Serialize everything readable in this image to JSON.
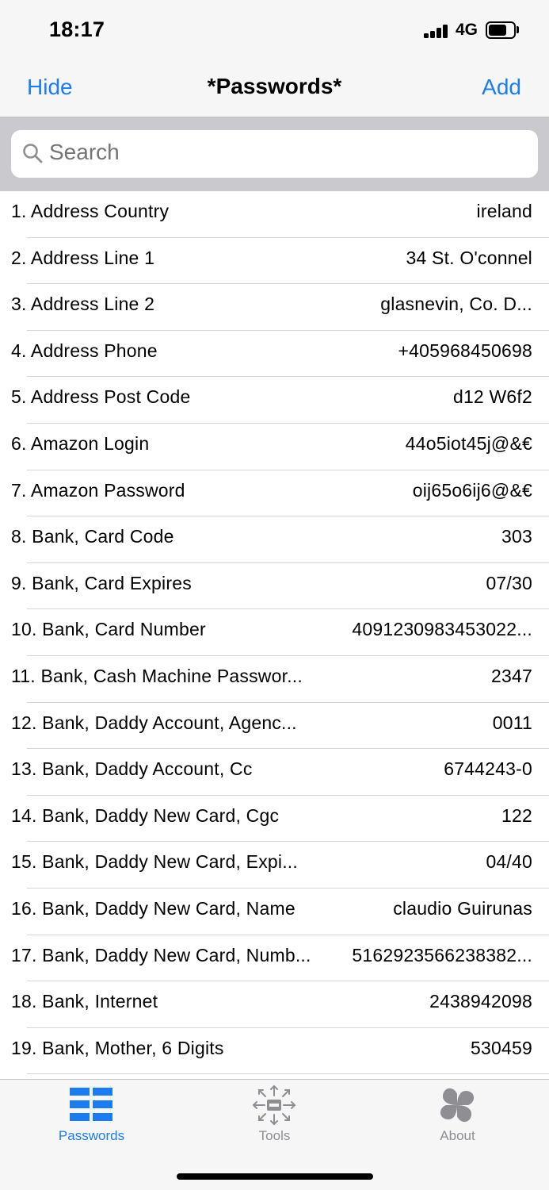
{
  "status": {
    "time": "18:17",
    "network": "4G"
  },
  "nav": {
    "left": "Hide",
    "title": "*Passwords*",
    "right": "Add"
  },
  "search": {
    "placeholder": "Search",
    "value": ""
  },
  "list": [
    {
      "label": "1. Address Country",
      "value": "ireland"
    },
    {
      "label": "2. Address Line 1",
      "value": "34 St. O'connel"
    },
    {
      "label": "3. Address Line 2",
      "value": "glasnevin, Co. D..."
    },
    {
      "label": "4. Address Phone",
      "value": "+405968450698"
    },
    {
      "label": "5. Address Post Code",
      "value": "d12 W6f2"
    },
    {
      "label": "6. Amazon Login",
      "value": "44o5iot45j@&€"
    },
    {
      "label": "7. Amazon Password",
      "value": "oij65o6ij6@&€"
    },
    {
      "label": "8. Bank, Card Code",
      "value": "303"
    },
    {
      "label": "9. Bank, Card Expires",
      "value": "07/30"
    },
    {
      "label": "10. Bank, Card Number",
      "value": "4091230983453022..."
    },
    {
      "label": "11. Bank, Cash Machine Passwor...",
      "value": "2347"
    },
    {
      "label": "12. Bank, Daddy Account, Agenc...",
      "value": "0011"
    },
    {
      "label": "13. Bank, Daddy Account, Cc",
      "value": "6744243-0"
    },
    {
      "label": "14. Bank, Daddy New Card, Cgc",
      "value": "122"
    },
    {
      "label": "15. Bank, Daddy New Card, Expi...",
      "value": "04/40"
    },
    {
      "label": "16. Bank, Daddy New Card, Name",
      "value": "claudio Guirunas"
    },
    {
      "label": "17. Bank, Daddy New Card, Numb...",
      "value": "5162923566238382..."
    },
    {
      "label": "18. Bank, Internet",
      "value": "2438942098"
    },
    {
      "label": "19. Bank, Mother, 6 Digits",
      "value": "530459"
    }
  ],
  "tabs": [
    {
      "label": "Passwords",
      "icon": "list-grid-icon",
      "active": true
    },
    {
      "label": "Tools",
      "icon": "tools-expand-icon",
      "active": false
    },
    {
      "label": "About",
      "icon": "clover-icon",
      "active": false
    }
  ],
  "colors": {
    "accent": "#1c7cf0",
    "inactive": "#8e8e93",
    "separator": "#d6d6da",
    "search_bg": "#c9c9ce"
  }
}
